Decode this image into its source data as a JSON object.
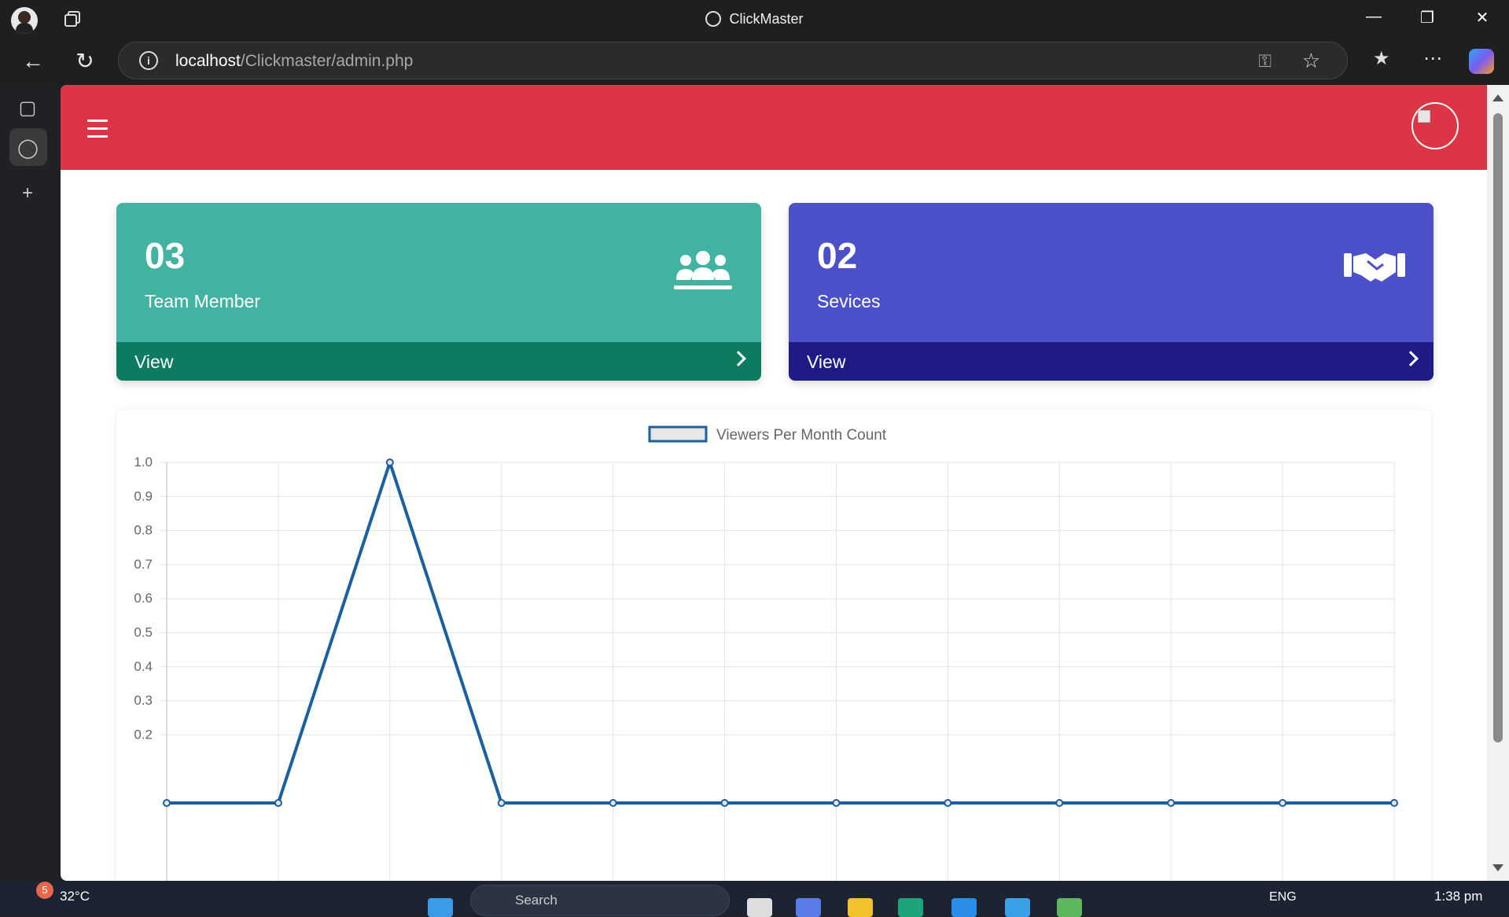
{
  "window": {
    "title": "ClickMaster"
  },
  "browser": {
    "url_host": "localhost",
    "url_path": "/Clickmaster/admin.php"
  },
  "cards": [
    {
      "count": "03",
      "label": "Team Member",
      "view_label": "View",
      "color": "#42b3a0",
      "footer_color": "#0d7a62",
      "icon": "users-icon"
    },
    {
      "count": "02",
      "label": "Sevices",
      "view_label": "View",
      "color": "#4c51c9",
      "footer_color": "#1e1a86",
      "icon": "handshake-icon"
    }
  ],
  "chart_data": {
    "type": "line",
    "title": "",
    "series": [
      {
        "name": "Viewers Per Month Count",
        "color": "#1a5f9e",
        "values": [
          0,
          0,
          1,
          0,
          0,
          0,
          0,
          0,
          0,
          0,
          0,
          0
        ]
      }
    ],
    "y_ticks": [
      "1.0",
      "0.9",
      "0.8",
      "0.7",
      "0.6",
      "0.5",
      "0.4",
      "0.3",
      "0.2"
    ],
    "ylim": [
      0,
      1
    ],
    "grid": true,
    "legend_position": "top-center"
  },
  "taskbar": {
    "temperature": "32°C",
    "notification_count": "5",
    "search_placeholder": "Search",
    "language": "ENG",
    "time": "1:38 pm"
  }
}
